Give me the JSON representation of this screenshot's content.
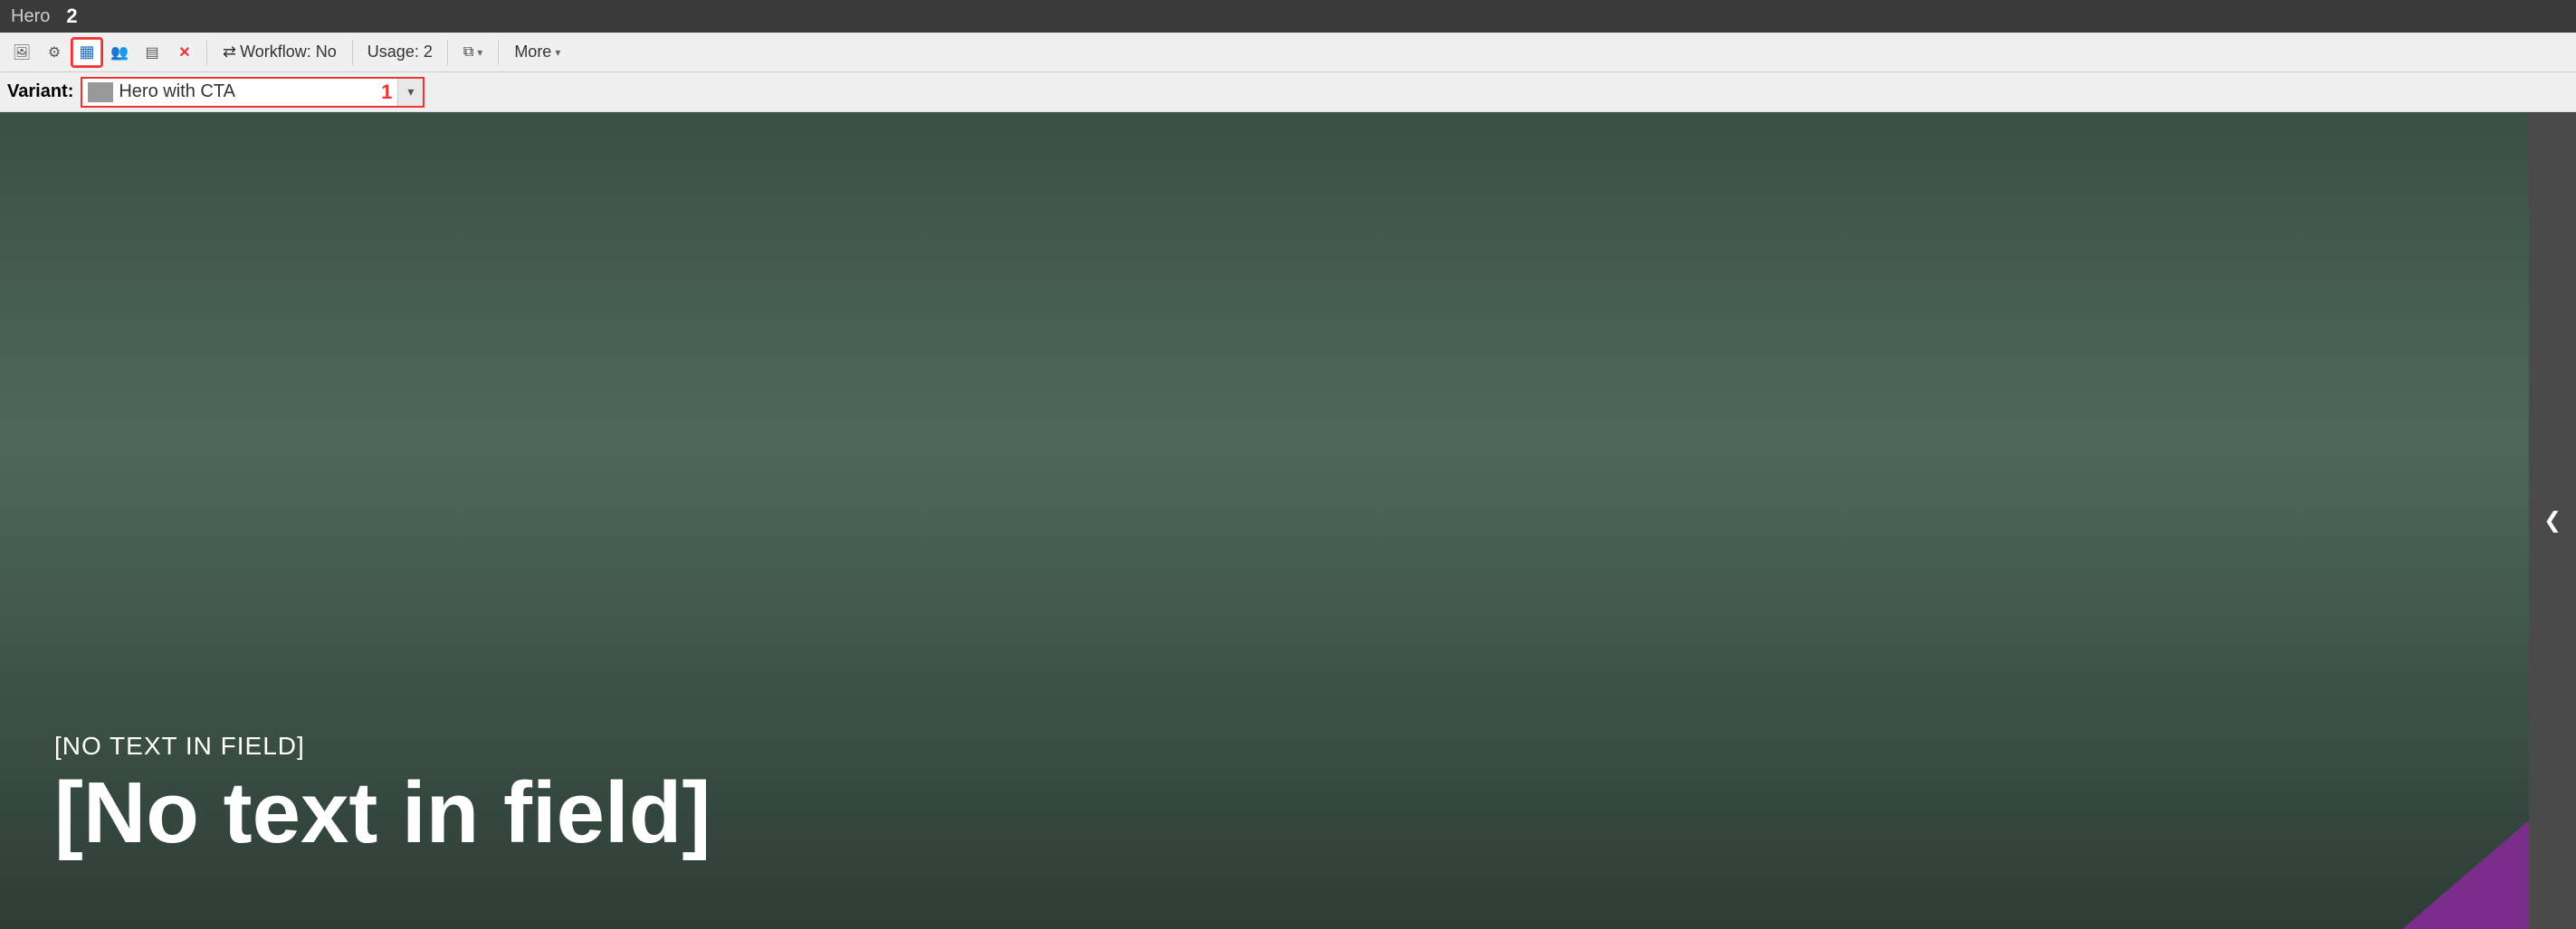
{
  "title_bar": {
    "component_name": "Hero",
    "component_number": "2"
  },
  "toolbar": {
    "buttons": [
      {
        "id": "image-btn",
        "icon": "🖼",
        "label": "image",
        "active": false
      },
      {
        "id": "settings-btn",
        "icon": "⚙",
        "label": "settings",
        "active": false
      },
      {
        "id": "layout-btn",
        "icon": "▦",
        "label": "layout",
        "active": true
      },
      {
        "id": "people-btn",
        "icon": "👥",
        "label": "people",
        "active": false
      },
      {
        "id": "columns-btn",
        "icon": "▤",
        "label": "columns",
        "active": false
      },
      {
        "id": "delete-btn",
        "icon": "✕",
        "label": "delete",
        "active": false
      }
    ],
    "workflow_label": "Workflow: No",
    "usage_label": "Usage: 2",
    "more_label": "More"
  },
  "variant_bar": {
    "label": "Variant:",
    "selected_variant": "Hero with CTA",
    "variant_number": "1",
    "dropdown_arrow": "▼"
  },
  "hero": {
    "subtitle": "[NO TEXT IN FIELD]",
    "title": "[No text in field]"
  },
  "right_panel": {
    "chevron": "❮"
  },
  "icons": {
    "chevron_down": "▾",
    "chevron_left": "❮"
  }
}
